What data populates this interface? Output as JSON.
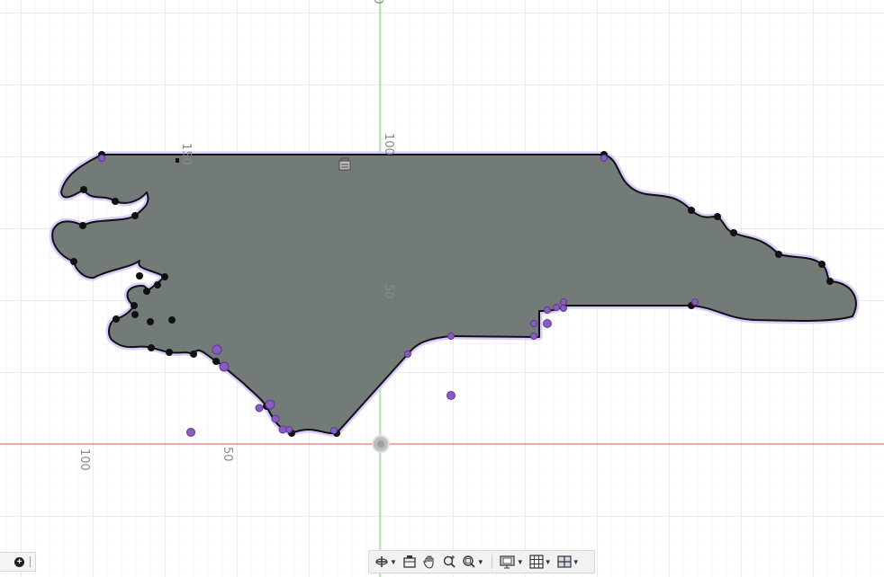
{
  "viewport": {
    "axis_labels": {
      "vertical_top": "50",
      "vertical_100": "100",
      "vertical_50": "50",
      "horizontal_100": "100",
      "horizontal_50": "50",
      "dimension_150": "150"
    }
  },
  "colors": {
    "background": "#ffffff",
    "grid_major": "#dcdcdc",
    "grid_minor": "#efefef",
    "x_axis": "#e05050",
    "y_axis": "#66cc66",
    "profile_fill": "#737b79",
    "profile_outline": "#111111",
    "offset_highlight": "#c8b6ff",
    "constraint_point": "#8a5cc2"
  },
  "toolbar": {
    "items": [
      {
        "name": "orbit",
        "icon": "orbit-icon",
        "has_dropdown": true
      },
      {
        "name": "look-at",
        "icon": "look-at-icon",
        "has_dropdown": false
      },
      {
        "name": "pan",
        "icon": "pan-hand-icon",
        "has_dropdown": false
      },
      {
        "name": "zoom",
        "icon": "zoom-icon",
        "has_dropdown": false
      },
      {
        "name": "fit",
        "icon": "zoom-window-icon",
        "has_dropdown": true
      },
      {
        "name": "display-settings",
        "icon": "display-settings-icon",
        "has_dropdown": true
      },
      {
        "name": "grid-snaps",
        "icon": "grid-icon",
        "has_dropdown": true
      },
      {
        "name": "viewports",
        "icon": "viewports-icon",
        "has_dropdown": true
      }
    ]
  }
}
